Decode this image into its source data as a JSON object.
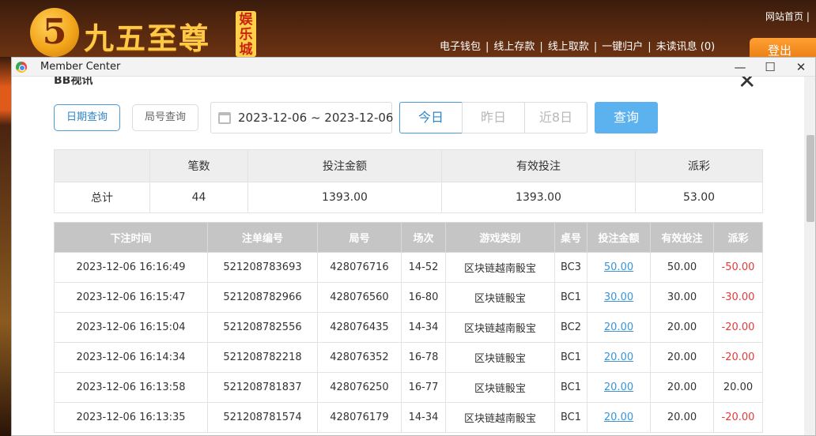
{
  "site": {
    "logo_digit": "5",
    "logo_name": "九五至尊",
    "logo_badge": "娱乐城",
    "top_links": "网站首页 | ",
    "nav": [
      "电子钱包",
      "线上存款",
      "线上取款",
      "一键归户",
      "未读讯息 (0)"
    ],
    "logout": "登出"
  },
  "window": {
    "title": "Member Center",
    "minimize": "—",
    "maximize": "☐",
    "close": "✕"
  },
  "page": {
    "section_title": "BB视讯",
    "close_glyph": "✕"
  },
  "filters": {
    "tab_date": "日期查询",
    "tab_round": "局号查询",
    "date_range": "2023-12-06 ~ 2023-12-06",
    "range_today": "今日",
    "range_yesterday": "昨日",
    "range_8days": "近8日",
    "query": "查询"
  },
  "summary": {
    "headers": [
      "",
      "笔数",
      "投注金额",
      "有效投注",
      "派彩"
    ],
    "row": [
      "总计",
      "44",
      "1393.00",
      "1393.00",
      "53.00"
    ]
  },
  "detail": {
    "headers": [
      "下注时间",
      "注单编号",
      "局号",
      "场次",
      "游戏类别",
      "桌号",
      "投注金额",
      "有效投注",
      "派彩"
    ],
    "rows": [
      [
        "2023-12-06 16:16:49",
        "521208783693",
        "428076716",
        "14-52",
        "区块链越南骰宝",
        "BC3",
        "50.00",
        "50.00",
        "-50.00"
      ],
      [
        "2023-12-06 16:15:47",
        "521208782966",
        "428076560",
        "16-80",
        "区块链骰宝",
        "BC1",
        "30.00",
        "30.00",
        "-30.00"
      ],
      [
        "2023-12-06 16:15:04",
        "521208782556",
        "428076435",
        "14-34",
        "区块链越南骰宝",
        "BC2",
        "20.00",
        "20.00",
        "-20.00"
      ],
      [
        "2023-12-06 16:14:34",
        "521208782218",
        "428076352",
        "16-78",
        "区块链骰宝",
        "BC1",
        "20.00",
        "20.00",
        "-20.00"
      ],
      [
        "2023-12-06 16:13:58",
        "521208781837",
        "428076250",
        "16-77",
        "区块链骰宝",
        "BC1",
        "20.00",
        "20.00",
        "20.00"
      ],
      [
        "2023-12-06 16:13:35",
        "521208781574",
        "428076179",
        "14-34",
        "区块链越南骰宝",
        "BC1",
        "20.00",
        "20.00",
        "-20.00"
      ]
    ]
  },
  "colors": {
    "accent": "#2f86c8",
    "query_button": "#5cb2ef",
    "negative": "#e23b3b",
    "link": "#3a95d8"
  }
}
